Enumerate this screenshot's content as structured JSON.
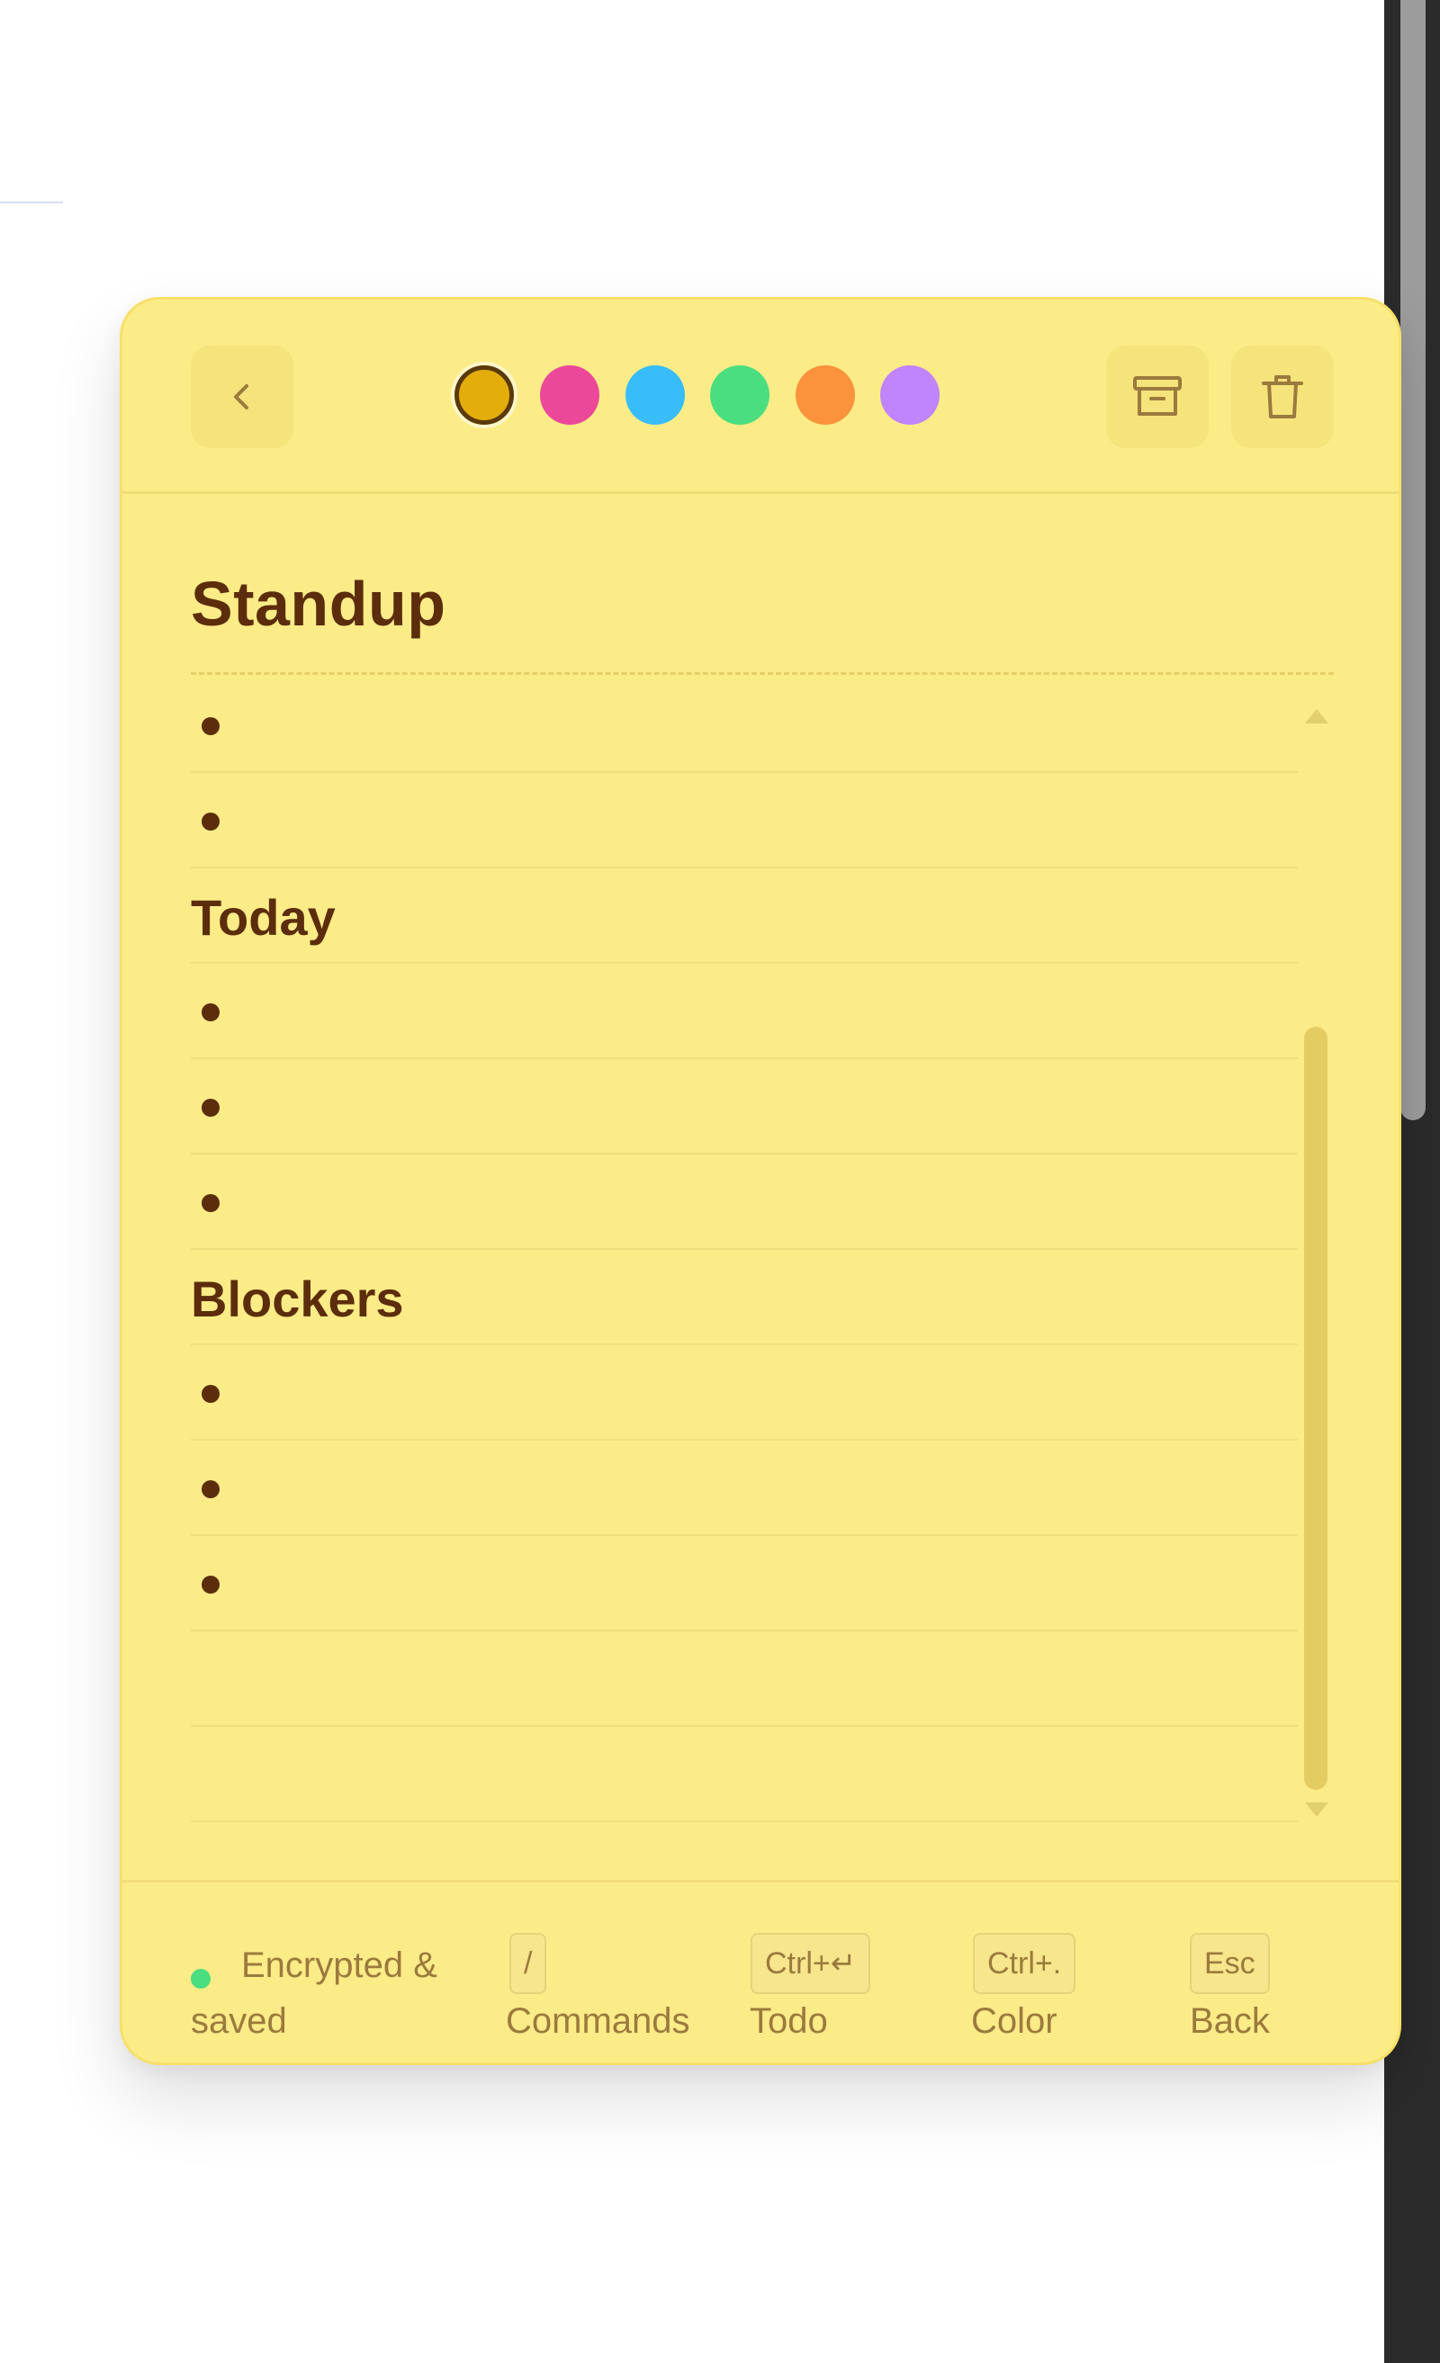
{
  "toolbar": {
    "back_icon": "chevron-left-icon",
    "archive_icon": "archive-icon",
    "delete_icon": "trash-icon",
    "swatches": [
      {
        "name": "amber",
        "color": "#e3ad0b",
        "selected": true
      },
      {
        "name": "pink",
        "color": "#ec4899",
        "selected": false
      },
      {
        "name": "sky",
        "color": "#38bdf8",
        "selected": false
      },
      {
        "name": "green",
        "color": "#4ade80",
        "selected": false
      },
      {
        "name": "orange",
        "color": "#fb923c",
        "selected": false
      },
      {
        "name": "purple",
        "color": "#c084fc",
        "selected": false
      }
    ]
  },
  "note": {
    "title": "Standup",
    "background": "#fcec88",
    "rows": [
      {
        "type": "bullet",
        "text": ""
      },
      {
        "type": "bullet",
        "text": ""
      },
      {
        "type": "heading",
        "text": "Today"
      },
      {
        "type": "bullet",
        "text": ""
      },
      {
        "type": "bullet",
        "text": ""
      },
      {
        "type": "bullet",
        "text": ""
      },
      {
        "type": "heading",
        "text": "Blockers"
      },
      {
        "type": "bullet",
        "text": ""
      },
      {
        "type": "bullet",
        "text": ""
      },
      {
        "type": "bullet",
        "text": ""
      },
      {
        "type": "empty",
        "text": ""
      },
      {
        "type": "empty",
        "text": ""
      }
    ]
  },
  "footer": {
    "status_color": "#4ade80",
    "status_line1": "Encrypted &",
    "status_line2": "saved",
    "shortcuts": [
      {
        "key": "/",
        "label": "Commands"
      },
      {
        "key": "Ctrl+↵",
        "label": "Todo"
      },
      {
        "key": "Ctrl+.",
        "label": "Color"
      },
      {
        "key": "Esc",
        "label": "Back"
      }
    ]
  }
}
